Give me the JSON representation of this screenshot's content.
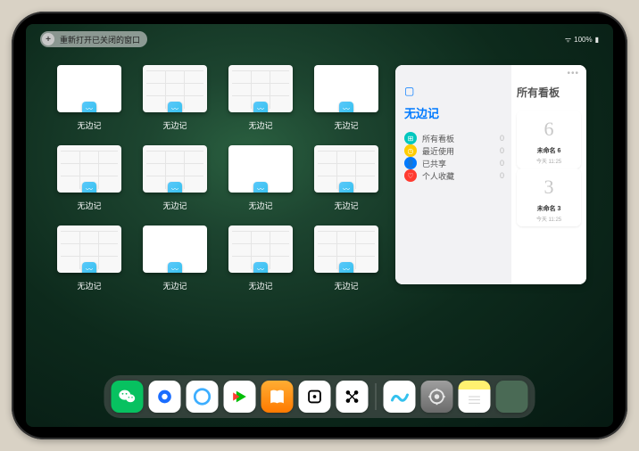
{
  "status": {
    "battery": "100%",
    "wifi": "⋮"
  },
  "top_chip": {
    "plus": "+",
    "label": "重新打开已关闭的窗口"
  },
  "app_name": "无边记",
  "windows": [
    {
      "label": "无边记",
      "preview": "blank"
    },
    {
      "label": "无边记",
      "preview": "grid"
    },
    {
      "label": "无边记",
      "preview": "grid"
    },
    {
      "label": "无边记",
      "preview": "blank"
    },
    {
      "label": "无边记",
      "preview": "grid"
    },
    {
      "label": "无边记",
      "preview": "grid"
    },
    {
      "label": "无边记",
      "preview": "blank"
    },
    {
      "label": "无边记",
      "preview": "grid"
    },
    {
      "label": "无边记",
      "preview": "grid"
    },
    {
      "label": "无边记",
      "preview": "blank"
    },
    {
      "label": "无边记",
      "preview": "grid"
    },
    {
      "label": "无边记",
      "preview": "grid"
    }
  ],
  "panel": {
    "left_title": "无边记",
    "right_title": "所有看板",
    "ellipsis": "•••",
    "items": [
      {
        "icon": "⊞",
        "color": "#00c7be",
        "label": "所有看板",
        "count": "0"
      },
      {
        "icon": "◷",
        "color": "#ffcc00",
        "label": "最近使用",
        "count": "0"
      },
      {
        "icon": "👤",
        "color": "#007aff",
        "label": "已共享",
        "count": "0"
      },
      {
        "icon": "♡",
        "color": "#ff3b30",
        "label": "个人收藏",
        "count": "0"
      }
    ],
    "boards": [
      {
        "glyph": "6",
        "label": "未命名 6",
        "sub": "今天 11:25"
      },
      {
        "glyph": "3",
        "label": "未命名 3",
        "sub": "今天 11:25"
      }
    ]
  },
  "dock": [
    {
      "name": "wechat",
      "class": "i-wechat"
    },
    {
      "name": "qq-hd",
      "class": "i-qqhd"
    },
    {
      "name": "qq-browser",
      "class": "i-qbrowser"
    },
    {
      "name": "iqiyi",
      "class": "i-iqiyi"
    },
    {
      "name": "books",
      "class": "i-books"
    },
    {
      "name": "dice-app",
      "class": "i-dice"
    },
    {
      "name": "connect-app",
      "class": "i-connect"
    },
    {
      "name": "sep"
    },
    {
      "name": "freeform",
      "class": "i-freeform"
    },
    {
      "name": "settings",
      "class": "i-settings"
    },
    {
      "name": "notes",
      "class": "i-notes"
    },
    {
      "name": "app-library",
      "class": "i-applib"
    }
  ]
}
